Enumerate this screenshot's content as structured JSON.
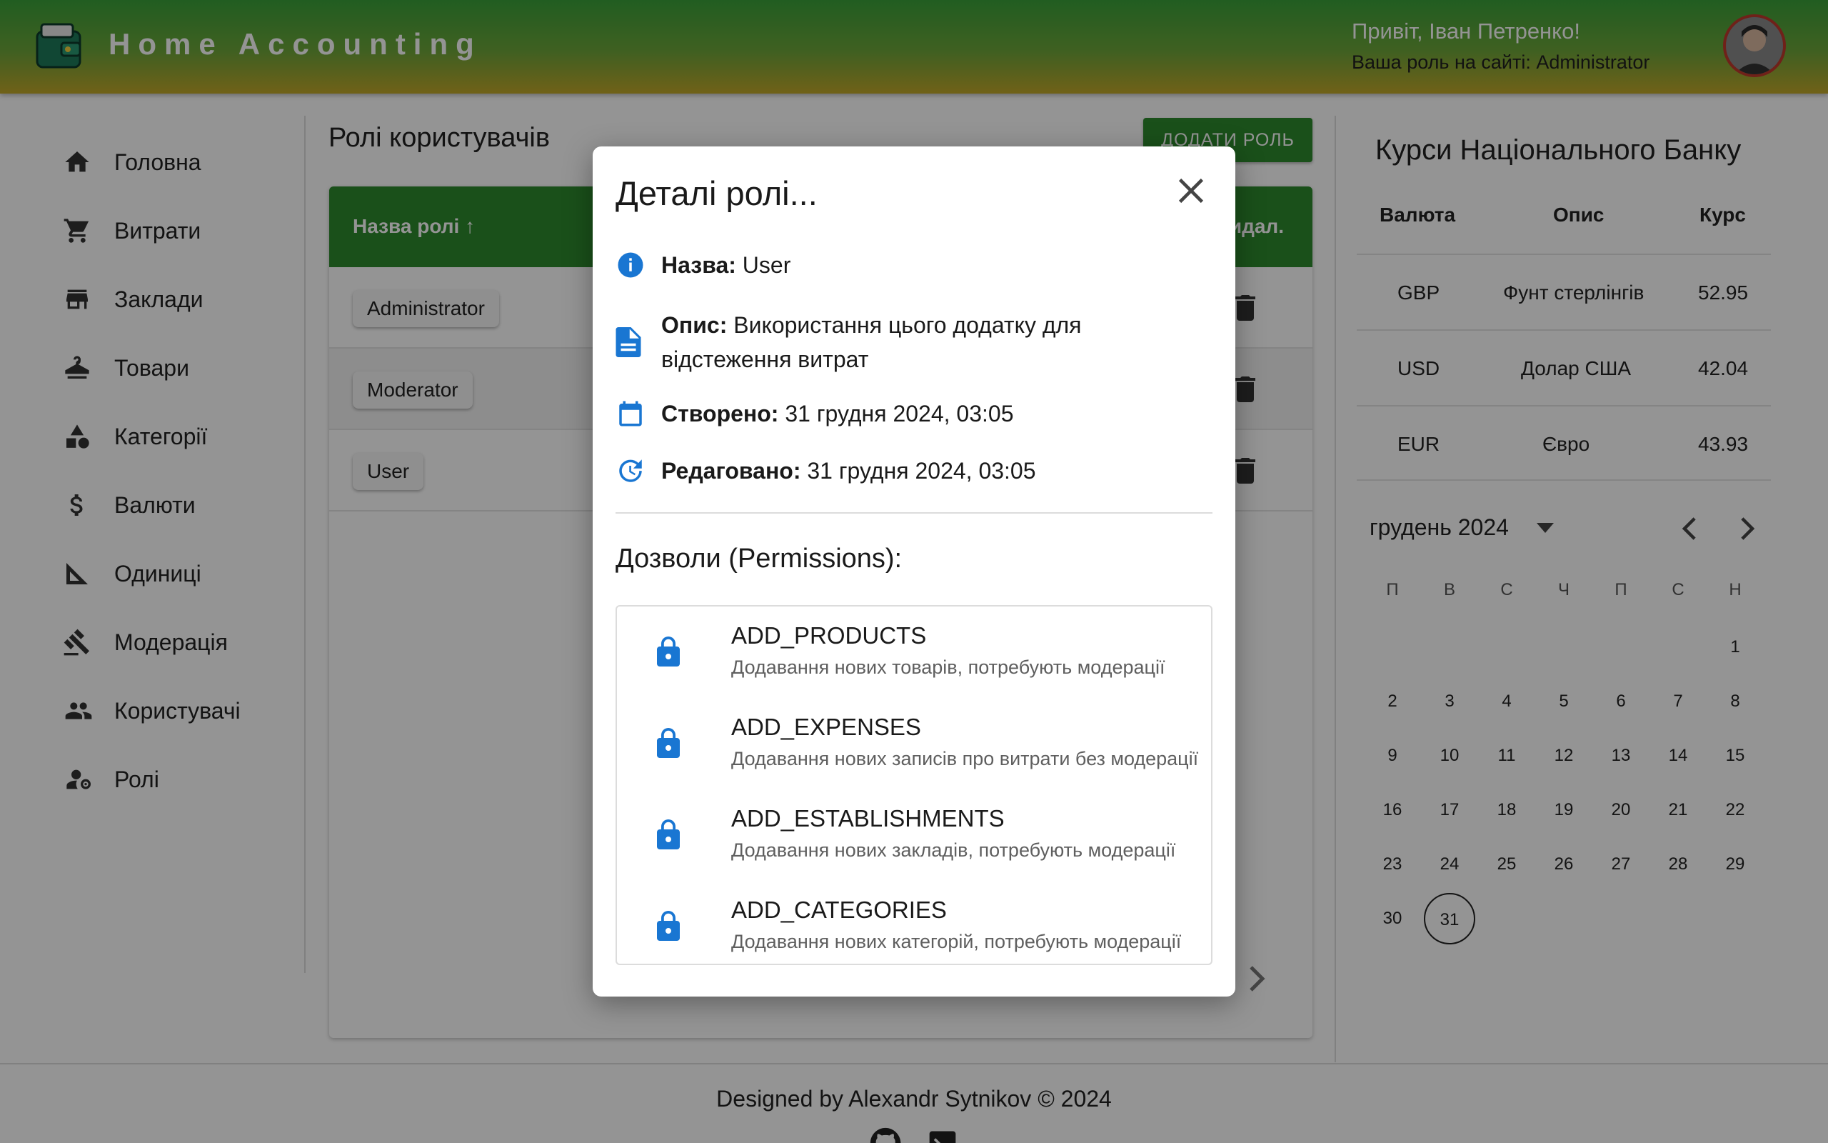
{
  "header": {
    "app_title": "Home Accounting",
    "greeting": "Привіт, Іван Петренко!",
    "role_line": "Ваша роль на сайті: Administrator"
  },
  "sidebar": {
    "items": [
      {
        "label": "Головна",
        "icon": "home-icon"
      },
      {
        "label": "Витрати",
        "icon": "cart-icon"
      },
      {
        "label": "Заклади",
        "icon": "store-icon"
      },
      {
        "label": "Товари",
        "icon": "hanger-icon"
      },
      {
        "label": "Категорії",
        "icon": "category-icon"
      },
      {
        "label": "Валюти",
        "icon": "dollar-icon"
      },
      {
        "label": "Одиниці",
        "icon": "ruler-icon"
      },
      {
        "label": "Модерація",
        "icon": "gavel-icon"
      },
      {
        "label": "Користувачі",
        "icon": "people-icon"
      },
      {
        "label": "Ролі",
        "icon": "user-gear-icon"
      }
    ]
  },
  "main": {
    "page_title": "Ролі користувачів",
    "add_button": "ДОДАТИ РОЛЬ",
    "table": {
      "col_name": "Назва ролі ↑",
      "col_delete": "Видал.",
      "rows": [
        "Administrator",
        "Moderator",
        "User"
      ]
    }
  },
  "rates": {
    "title": "Курси Національного Банку",
    "headers": [
      "Валюта",
      "Опис",
      "Курс"
    ],
    "rows": [
      {
        "code": "GBP",
        "desc": "Фунт стерлінгів",
        "rate": "52.95"
      },
      {
        "code": "USD",
        "desc": "Долар США",
        "rate": "42.04"
      },
      {
        "code": "EUR",
        "desc": "Євро",
        "rate": "43.93"
      }
    ]
  },
  "calendar": {
    "month": "грудень 2024",
    "weekdays": [
      "П",
      "В",
      "С",
      "Ч",
      "П",
      "С",
      "Н"
    ],
    "first_weekday_index": 6,
    "days_in_month": 31,
    "selected_day": 31
  },
  "footer": {
    "text": "Designed by Alexandr Sytnikov © 2024"
  },
  "modal": {
    "title": "Деталі ролі...",
    "name_label": "Назва:",
    "name_value": "User",
    "desc_label": "Опис:",
    "desc_value": "Використання цього додатку для відстеження витрат",
    "created_label": "Створено:",
    "created_value": "31 грудня 2024, 03:05",
    "edited_label": "Редаговано:",
    "edited_value": "31 грудня 2024, 03:05",
    "permissions_title": "Дозволи (Permissions):",
    "permissions": [
      {
        "name": "ADD_PRODUCTS",
        "desc": "Додавання нових товарів, потребують модерації"
      },
      {
        "name": "ADD_EXPENSES",
        "desc": "Додавання нових записів про витрати без модерації"
      },
      {
        "name": "ADD_ESTABLISHMENTS",
        "desc": "Додавання нових закладів, потребують модерації"
      },
      {
        "name": "ADD_CATEGORIES",
        "desc": "Додавання нових категорій, потребують модерації"
      }
    ]
  },
  "colors": {
    "primary_green": "#2e8b2e",
    "icon_blue": "#1976d2",
    "header_gradient_end": "#c2a72a"
  }
}
